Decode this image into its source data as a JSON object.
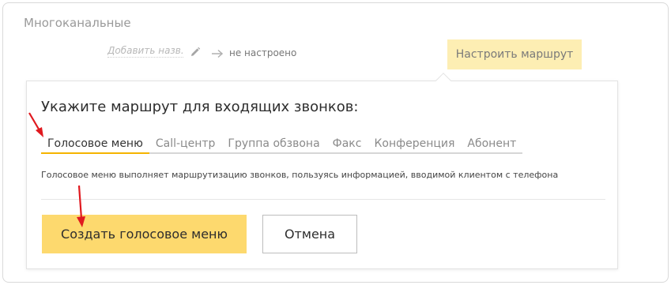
{
  "section": {
    "title": "Многоканальные",
    "name_placeholder": "Добавить назв...",
    "status": "не настроено",
    "configure_button": "Настроить маршрут"
  },
  "panel": {
    "heading": "Укажите маршрут для входящих звонков:",
    "tabs": [
      {
        "label": "Голосовое меню",
        "active": true
      },
      {
        "label": "Call-центр",
        "active": false
      },
      {
        "label": "Группа обзвона",
        "active": false
      },
      {
        "label": "Факс",
        "active": false
      },
      {
        "label": "Конференция",
        "active": false
      },
      {
        "label": "Абонент",
        "active": false
      }
    ],
    "description": "Голосовое меню выполняет маршрутизацию звонков, пользуясь информацией, вводимой клиентом с телефона",
    "create_button": "Создать голосовое меню",
    "cancel_button": "Отмена"
  },
  "icons": {
    "edit": "pencil-icon",
    "arrow": "arrow-right-icon",
    "annotation": "red-arrow-icon"
  },
  "colors": {
    "accent": "#f5b400",
    "primary_button": "#fdd96e",
    "secondary_highlight": "#fdeeb3",
    "annotation": "#e0191f"
  }
}
